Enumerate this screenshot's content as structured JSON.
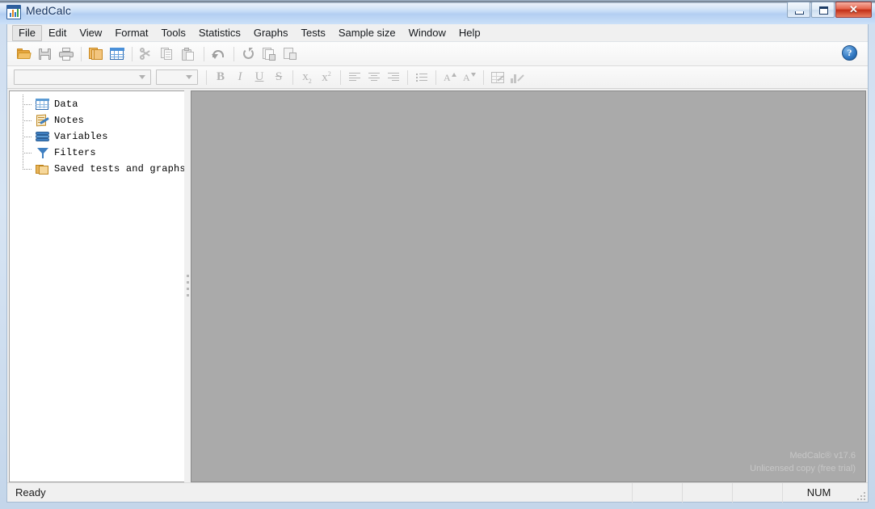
{
  "window": {
    "title": "MedCalc",
    "app_icon": "chart-spreadsheet-icon",
    "buttons": {
      "minimize": "minimize-icon",
      "maximize": "maximize-icon",
      "close": "✕"
    }
  },
  "menubar": {
    "items": [
      {
        "label": "File",
        "active": true
      },
      {
        "label": "Edit",
        "active": false
      },
      {
        "label": "View",
        "active": false
      },
      {
        "label": "Format",
        "active": false
      },
      {
        "label": "Tools",
        "active": false
      },
      {
        "label": "Statistics",
        "active": false
      },
      {
        "label": "Graphs",
        "active": false
      },
      {
        "label": "Tests",
        "active": false
      },
      {
        "label": "Sample size",
        "active": false
      },
      {
        "label": "Window",
        "active": false
      },
      {
        "label": "Help",
        "active": false
      }
    ]
  },
  "toolbar_main": {
    "items": [
      {
        "name": "open-file-button",
        "icon": "open-folder-icon"
      },
      {
        "name": "save-file-button",
        "icon": "floppy-save-icon"
      },
      {
        "name": "print-button",
        "icon": "printer-icon"
      },
      {
        "name": "separator-1",
        "icon": "separator"
      },
      {
        "name": "copy-pages-button",
        "icon": "copy-pages-icon"
      },
      {
        "name": "spreadsheet-button",
        "icon": "grid-table-icon"
      },
      {
        "name": "separator-2",
        "icon": "separator"
      },
      {
        "name": "cut-button",
        "icon": "scissors-icon"
      },
      {
        "name": "copy-button",
        "icon": "copy-documents-icon"
      },
      {
        "name": "paste-button",
        "icon": "clipboard-paste-icon"
      },
      {
        "name": "separator-3",
        "icon": "separator"
      },
      {
        "name": "undo-button",
        "icon": "undo-arrow-icon"
      },
      {
        "name": "separator-4",
        "icon": "separator"
      },
      {
        "name": "refresh-button",
        "icon": "refresh-circle-icon"
      },
      {
        "name": "save-results-button",
        "icon": "document-save-icon"
      },
      {
        "name": "report-button",
        "icon": "document-stats-icon"
      }
    ],
    "help": {
      "name": "help-button",
      "icon": "question-mark-icon",
      "glyph": "?"
    }
  },
  "toolbar_format": {
    "font_combo": {
      "name": "font-family-combo",
      "value": "",
      "placeholder": ""
    },
    "size_combo": {
      "name": "font-size-combo",
      "value": "",
      "placeholder": ""
    },
    "buttons": [
      {
        "name": "bold-button",
        "label": "B",
        "icon": "bold-icon"
      },
      {
        "name": "italic-button",
        "label": "I",
        "icon": "italic-icon"
      },
      {
        "name": "underline-button",
        "label": "U",
        "icon": "underline-icon"
      },
      {
        "name": "strikethrough-button",
        "label": "S",
        "icon": "strikethrough-icon"
      },
      {
        "name": "subscript-button",
        "label": "x2",
        "icon": "subscript-icon"
      },
      {
        "name": "superscript-button",
        "label": "x2",
        "icon": "superscript-icon"
      },
      {
        "name": "align-left-button",
        "label": "",
        "icon": "align-left-icon"
      },
      {
        "name": "align-center-button",
        "label": "",
        "icon": "align-center-icon"
      },
      {
        "name": "align-right-button",
        "label": "",
        "icon": "align-right-icon"
      },
      {
        "name": "bullet-list-button",
        "label": "",
        "icon": "bullet-list-icon"
      },
      {
        "name": "increase-font-button",
        "label": "A",
        "icon": "font-grow-icon"
      },
      {
        "name": "decrease-font-button",
        "label": "A",
        "icon": "font-shrink-icon"
      },
      {
        "name": "edit-table-button",
        "label": "",
        "icon": "table-edit-icon"
      },
      {
        "name": "edit-graph-button",
        "label": "",
        "icon": "graph-edit-icon"
      }
    ]
  },
  "sidebar": {
    "tree": [
      {
        "label": "Data",
        "icon": "data-grid-icon"
      },
      {
        "label": "Notes",
        "icon": "notes-pencil-icon"
      },
      {
        "label": "Variables",
        "icon": "variables-layers-icon"
      },
      {
        "label": "Filters",
        "icon": "filter-funnel-icon"
      },
      {
        "label": "Saved tests and graphs",
        "icon": "saved-folders-icon"
      }
    ]
  },
  "main": {
    "watermark_line1": "MedCalc® v17.6",
    "watermark_line2": "Unlicensed copy (free trial)"
  },
  "statusbar": {
    "message": "Ready",
    "num_indicator": "NUM"
  },
  "colors": {
    "accent_blue": "#2f76c0",
    "accent_orange": "#e5a53c",
    "titlebar": "#bcd6f5",
    "workspace": "#aaaaaa",
    "close_button": "#c22e16"
  }
}
